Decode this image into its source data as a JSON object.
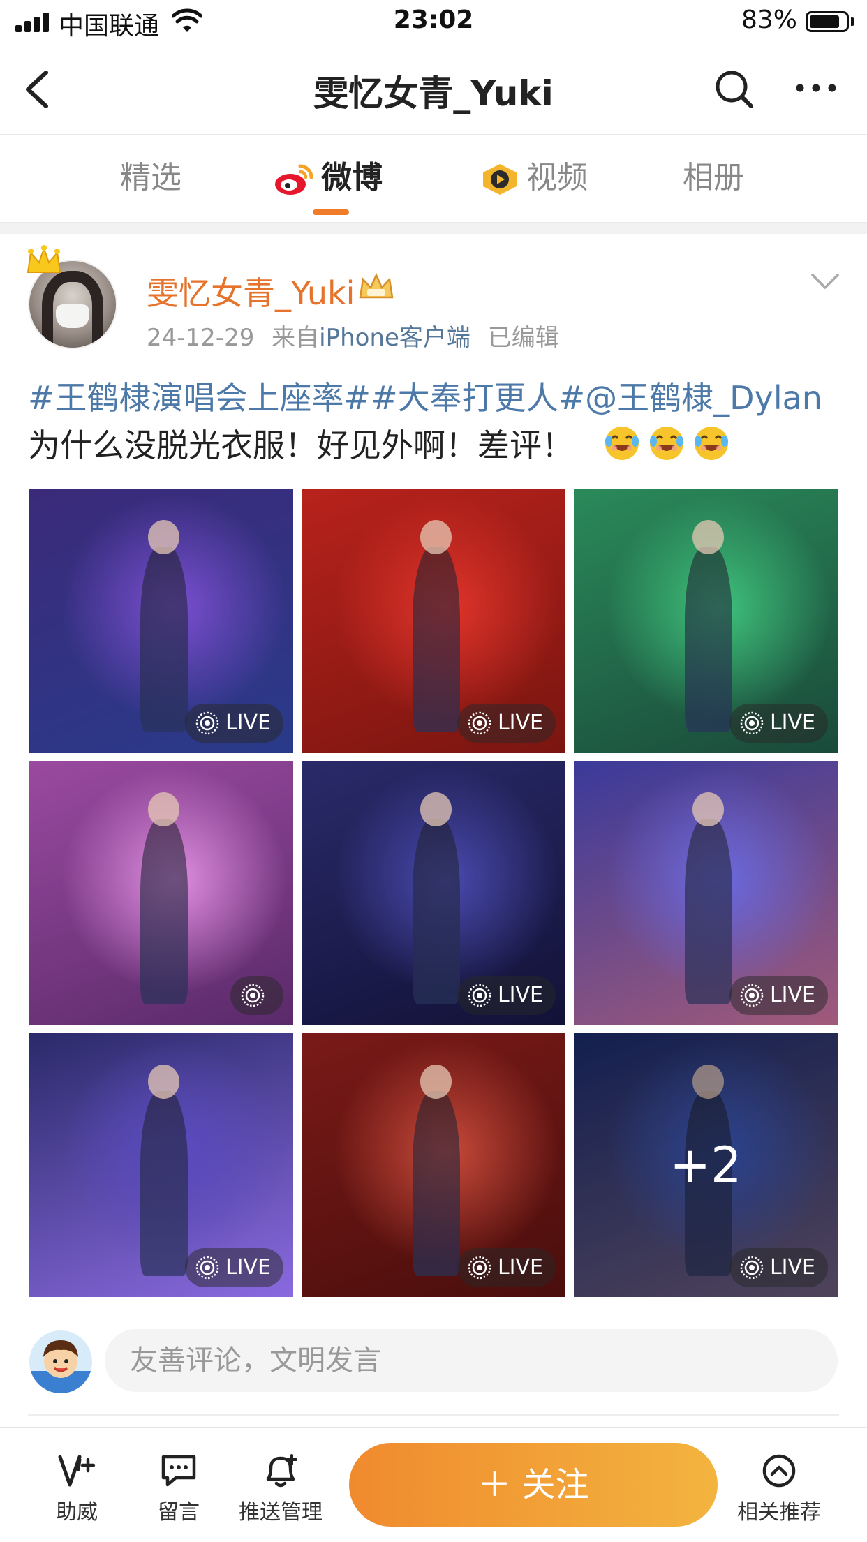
{
  "status_bar": {
    "carrier": "中国联通",
    "time": "23:02",
    "battery": "83%",
    "battery_level": 0.83
  },
  "nav": {
    "title": "雯忆女青_Yuki"
  },
  "tabs": [
    {
      "label": "精选",
      "active": false
    },
    {
      "label": "微博",
      "active": true,
      "icon": "weibo-logo-icon"
    },
    {
      "label": "视频",
      "active": false,
      "icon": "video-icon"
    },
    {
      "label": "相册",
      "active": false
    }
  ],
  "post": {
    "author": "雯忆女青_Yuki",
    "date": "24-12-29",
    "source_prefix": "来自",
    "source": "iPhone客户端",
    "edited": "已编辑",
    "text_tags": "#王鹤棣演唱会上座率##大奉打更人#@王鹤棣_Dylan",
    "text_body": "为什么没脱光衣服！好见外啊！差评！",
    "emoji_count": 3,
    "emoji": "laughing-crying-emoji"
  },
  "photos": [
    {
      "live": "LIVE",
      "theme": [
        "#3b2a7a",
        "#7b4fd0",
        "#2a3a8a"
      ]
    },
    {
      "live": "LIVE",
      "theme": [
        "#b8221c",
        "#e0342a",
        "#7a1510"
      ]
    },
    {
      "live": "LIVE",
      "theme": [
        "#2a8a5a",
        "#3fc27c",
        "#1a4a3a"
      ]
    },
    {
      "live": "",
      "theme": [
        "#9a4aa0",
        "#e08ee0",
        "#5a2a6a"
      ]
    },
    {
      "live": "LIVE",
      "theme": [
        "#2a2a6a",
        "#4a4ab0",
        "#121238"
      ]
    },
    {
      "live": "LIVE",
      "theme": [
        "#3a3a9a",
        "#6a6ae0",
        "#a05a7a"
      ]
    },
    {
      "live": "LIVE",
      "theme": [
        "#2a2a6a",
        "#5a4ac0",
        "#8a6ae0"
      ]
    },
    {
      "live": "LIVE",
      "theme": [
        "#7a1a18",
        "#c84a3a",
        "#4a0e0c"
      ]
    },
    {
      "live": "LIVE",
      "theme": [
        "#1a2a6a",
        "#3a5ac0",
        "#6a5a7a"
      ],
      "overlay": "+2"
    }
  ],
  "comment": {
    "placeholder": "友善评论，文明发言"
  },
  "toolbar": {
    "boost": "助威",
    "message": "留言",
    "push": "推送管理",
    "follow": "＋ 关注",
    "related": "相关推荐"
  },
  "colors": {
    "accent": "#f07c2a",
    "name": "#e5732b",
    "tag": "#4d79a8"
  }
}
